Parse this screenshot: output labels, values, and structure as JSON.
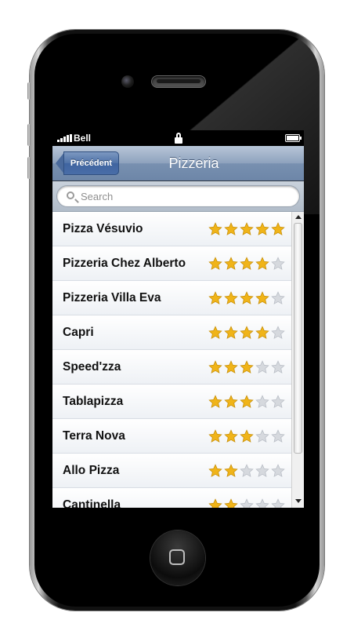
{
  "status": {
    "carrier": "Bell"
  },
  "nav": {
    "back_label": "Précédent",
    "title": "Pizzeria"
  },
  "search": {
    "placeholder": "Search",
    "value": ""
  },
  "colors": {
    "star_on": "#f0b419",
    "star_off": "#d6d9de",
    "nav_bar": "#7890b0"
  },
  "restaurants": [
    {
      "name": "Pizza Vésuvio",
      "rating": 5
    },
    {
      "name": "Pizzeria Chez Alberto",
      "rating": 4
    },
    {
      "name": "Pizzeria Villa Eva",
      "rating": 4
    },
    {
      "name": "Capri",
      "rating": 4
    },
    {
      "name": "Speed'zza",
      "rating": 3
    },
    {
      "name": "Tablapizza",
      "rating": 3
    },
    {
      "name": "Terra Nova",
      "rating": 3
    },
    {
      "name": "Allo Pizza",
      "rating": 2
    },
    {
      "name": "Cantinella",
      "rating": 2
    }
  ],
  "max_rating": 5
}
